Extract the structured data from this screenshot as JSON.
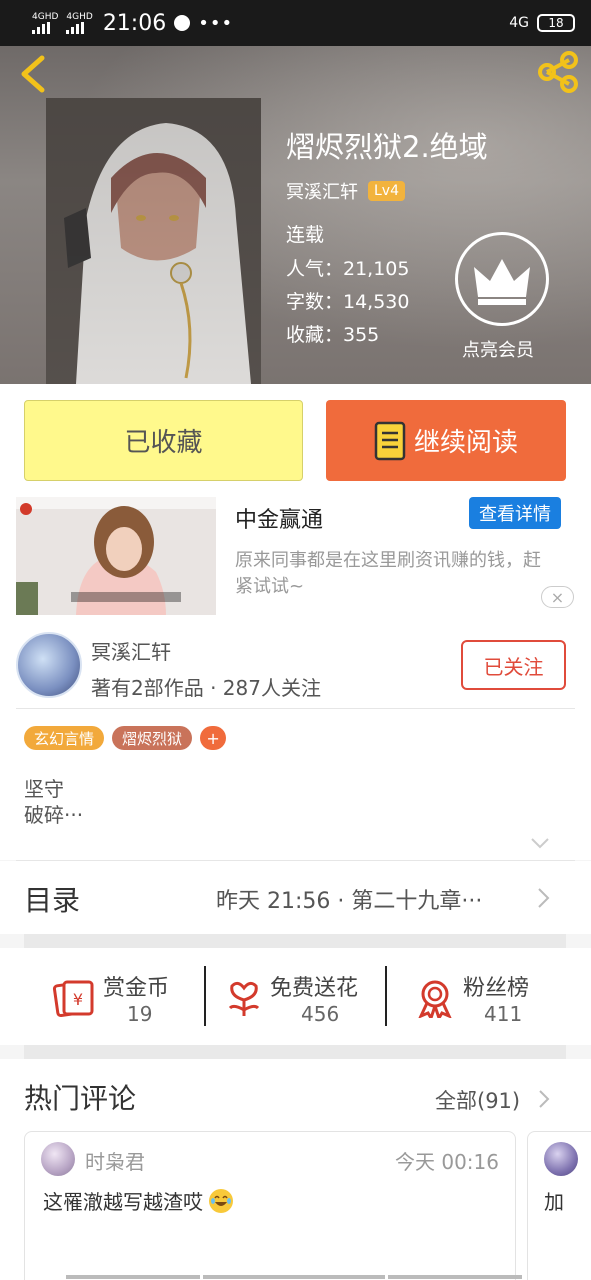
{
  "status_bar": {
    "network_1": "4GHD",
    "network_2": "4GHD",
    "time": "21:06",
    "network_right": "4G",
    "battery": "18"
  },
  "book": {
    "title": "熠烬烈狱2.绝域",
    "author": "冥溪汇轩",
    "level": "Lv4",
    "status": "连载",
    "popularity": "人气：21,105",
    "word_count": "字数：14,530",
    "favorites": "收藏：355",
    "vip_label": "点亮会员"
  },
  "actions": {
    "favorited_label": "已收藏",
    "continue_label": "继续阅读"
  },
  "ad": {
    "title": "中金赢通",
    "button": "查看详情",
    "description": "原来同事都是在这里刷资讯赚的钱，赶紧试试~",
    "close": "×"
  },
  "author_card": {
    "name": "冥溪汇轩",
    "works": "著有2部作品 · 287人关注",
    "follow_label": "已关注"
  },
  "tags": [
    "玄幻言情",
    "熠烬烈狱",
    "+"
  ],
  "intro": {
    "line_1": "坚守",
    "line_2": "破碎···"
  },
  "toc": {
    "label": "目录",
    "latest": "昨天 21:56 · 第二十九章···"
  },
  "rewards": [
    {
      "label": "赏金币",
      "value": "19"
    },
    {
      "label": "免费送花",
      "value": "456"
    },
    {
      "label": "粉丝榜",
      "value": "411"
    }
  ],
  "comments": {
    "header": "热门评论",
    "all_label": "全部(91)",
    "items": [
      {
        "user": "时枭君",
        "time": "今天 00:16",
        "text": "这罹澈越写越渣哎"
      },
      {
        "text": "加"
      }
    ]
  },
  "colors": {
    "accent_orange": "#f06b3c",
    "fav_yellow": "#fff98c",
    "follow_red": "#e04b3b",
    "ad_blue": "#1a7fe0",
    "level_gold": "#f2b33d"
  },
  "icons": [
    "back-arrow-icon",
    "share-icon",
    "crown-icon",
    "book-icon",
    "red-envelope-icon",
    "flower-icon",
    "medal-icon",
    "chevron-right-icon",
    "chevron-down-icon",
    "emoji-icon"
  ]
}
